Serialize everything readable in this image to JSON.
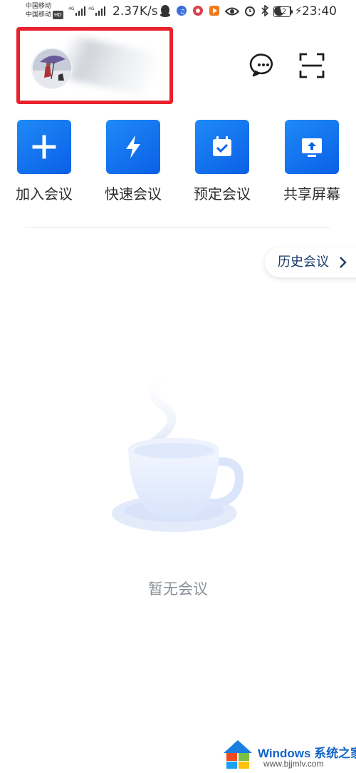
{
  "status_bar": {
    "carrier1": "中国移动",
    "carrier2": "中国移动",
    "hd": "HD",
    "net1": "4G",
    "net2": "4G",
    "speed": "2.37K/s",
    "battery": "32",
    "time": "23:40",
    "icons": [
      "qq-icon",
      "music-icon",
      "app-icon",
      "video-icon",
      "eye-icon",
      "alarm-icon",
      "bluetooth-icon",
      "moon-icon",
      "vibrate-icon"
    ]
  },
  "header": {
    "avatar": "user-avatar",
    "chat_icon": "chat-bubble-icon",
    "scan_icon": "scan-icon"
  },
  "actions": [
    {
      "label": "加入会议",
      "icon": "plus-icon"
    },
    {
      "label": "快速会议",
      "icon": "lightning-icon"
    },
    {
      "label": "预定会议",
      "icon": "calendar-check-icon"
    },
    {
      "label": "共享屏幕",
      "icon": "screen-share-icon"
    }
  ],
  "history": {
    "label": "历史会议"
  },
  "empty": {
    "text": "暂无会议"
  },
  "watermark": {
    "title": "Windows 系统之家",
    "url": "www.bjjmlv.com"
  },
  "colors": {
    "accent": "#0a6cf0",
    "highlight_box": "#e8212b"
  }
}
